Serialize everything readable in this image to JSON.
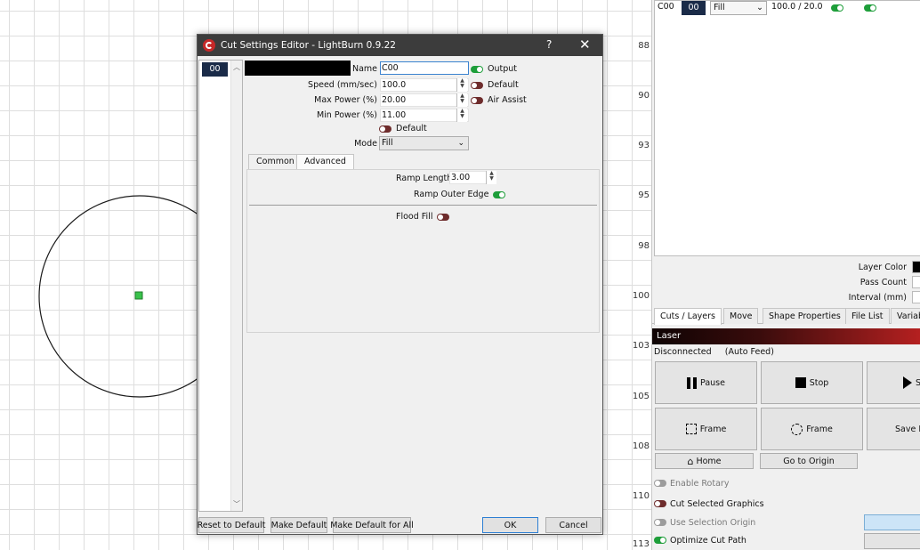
{
  "canvas": {
    "ruler_labels": [
      "88",
      "90",
      "93",
      "95",
      "98",
      "100",
      "103",
      "105",
      "108",
      "110",
      "113"
    ]
  },
  "right_panel": {
    "cut_row": {
      "name": "C00",
      "layer": "00",
      "mode": "Fill",
      "speed_power": "100.0 / 20.0"
    },
    "props": {
      "layer_color": "Layer Color",
      "pass_count": "Pass Count",
      "interval": "Interval (mm)"
    },
    "tabs": [
      "Cuts / Layers",
      "Move",
      "Shape Properties",
      "File List",
      "Variab"
    ],
    "laser_title": "Laser",
    "status": "Disconnected",
    "status_extra": "(Auto Feed)",
    "buttons": {
      "pause": "Pause",
      "stop": "Stop",
      "start": "S",
      "frame1": "Frame",
      "frame2": "Frame",
      "save": "Save R",
      "home": "Home",
      "go_origin": "Go to Origin"
    },
    "options": {
      "enable_rotary": "Enable Rotary",
      "cut_selected": "Cut Selected Graphics",
      "use_selection_origin": "Use Selection Origin",
      "optimize_cut_path": "Optimize Cut Path"
    }
  },
  "dialog": {
    "title": "Cut Settings Editor - LightBurn 0.9.22",
    "help": "?",
    "close": "✕",
    "layer_list": [
      "00"
    ],
    "name_label": "Name",
    "name_value": "C00",
    "speed_label": "Speed (mm/sec)",
    "speed_value": "100.0",
    "max_power_label": "Max Power (%)",
    "max_power_value": "20.00",
    "min_power_label": "Min Power (%)",
    "min_power_value": "11.00",
    "output_label": "Output",
    "default_label": "Default",
    "air_assist_label": "Air Assist",
    "default2_label": "Default",
    "mode_label": "Mode",
    "mode_value": "Fill",
    "tabs": [
      "Common",
      "Advanced"
    ],
    "ramp_length_label": "Ramp Length",
    "ramp_length_value": "3.00",
    "ramp_outer_edge_label": "Ramp Outer Edge",
    "flood_fill_label": "Flood Fill",
    "buttons": {
      "reset": "Reset to Default",
      "make_default": "Make Default",
      "make_default_all": "Make Default for All",
      "ok": "OK",
      "cancel": "Cancel"
    }
  }
}
